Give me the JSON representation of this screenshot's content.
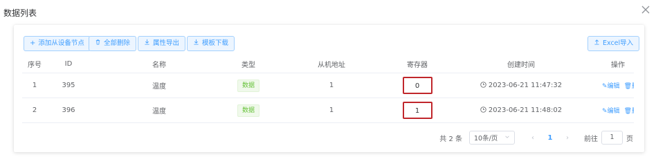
{
  "dialog": {
    "title": "数据列表"
  },
  "toolbar": {
    "add_label": "添加从设备节点",
    "delete_all_label": "全部删除",
    "export_attr_label": "属性导出",
    "template_label": "模板下载",
    "excel_import_label": "Excel导入"
  },
  "table": {
    "headers": {
      "seq": "序号",
      "id": "ID",
      "name": "名称",
      "type": "类型",
      "slave_addr": "从机地址",
      "register": "寄存器",
      "created": "创建时间",
      "ops": "操作"
    },
    "rows": [
      {
        "seq": "1",
        "id": "395",
        "name": "温度",
        "type": "数据",
        "slave_addr": "1",
        "register": "0",
        "created": "2023-06-21 11:47:32",
        "edit": "编辑",
        "delete": "删除"
      },
      {
        "seq": "2",
        "id": "396",
        "name": "温度",
        "type": "数据",
        "slave_addr": "1",
        "register": "1",
        "created": "2023-06-21 11:48:02",
        "edit": "编辑",
        "delete": "删除"
      }
    ]
  },
  "pagination": {
    "total": "共 2 条",
    "page_size": "10条/页",
    "current_page": "1",
    "goto_label": "前往",
    "goto_value": "1",
    "page_unit": "页"
  },
  "colors": {
    "primary": "#409eff",
    "tag_green": "#67c23a",
    "highlight_red": "#c0262b"
  }
}
